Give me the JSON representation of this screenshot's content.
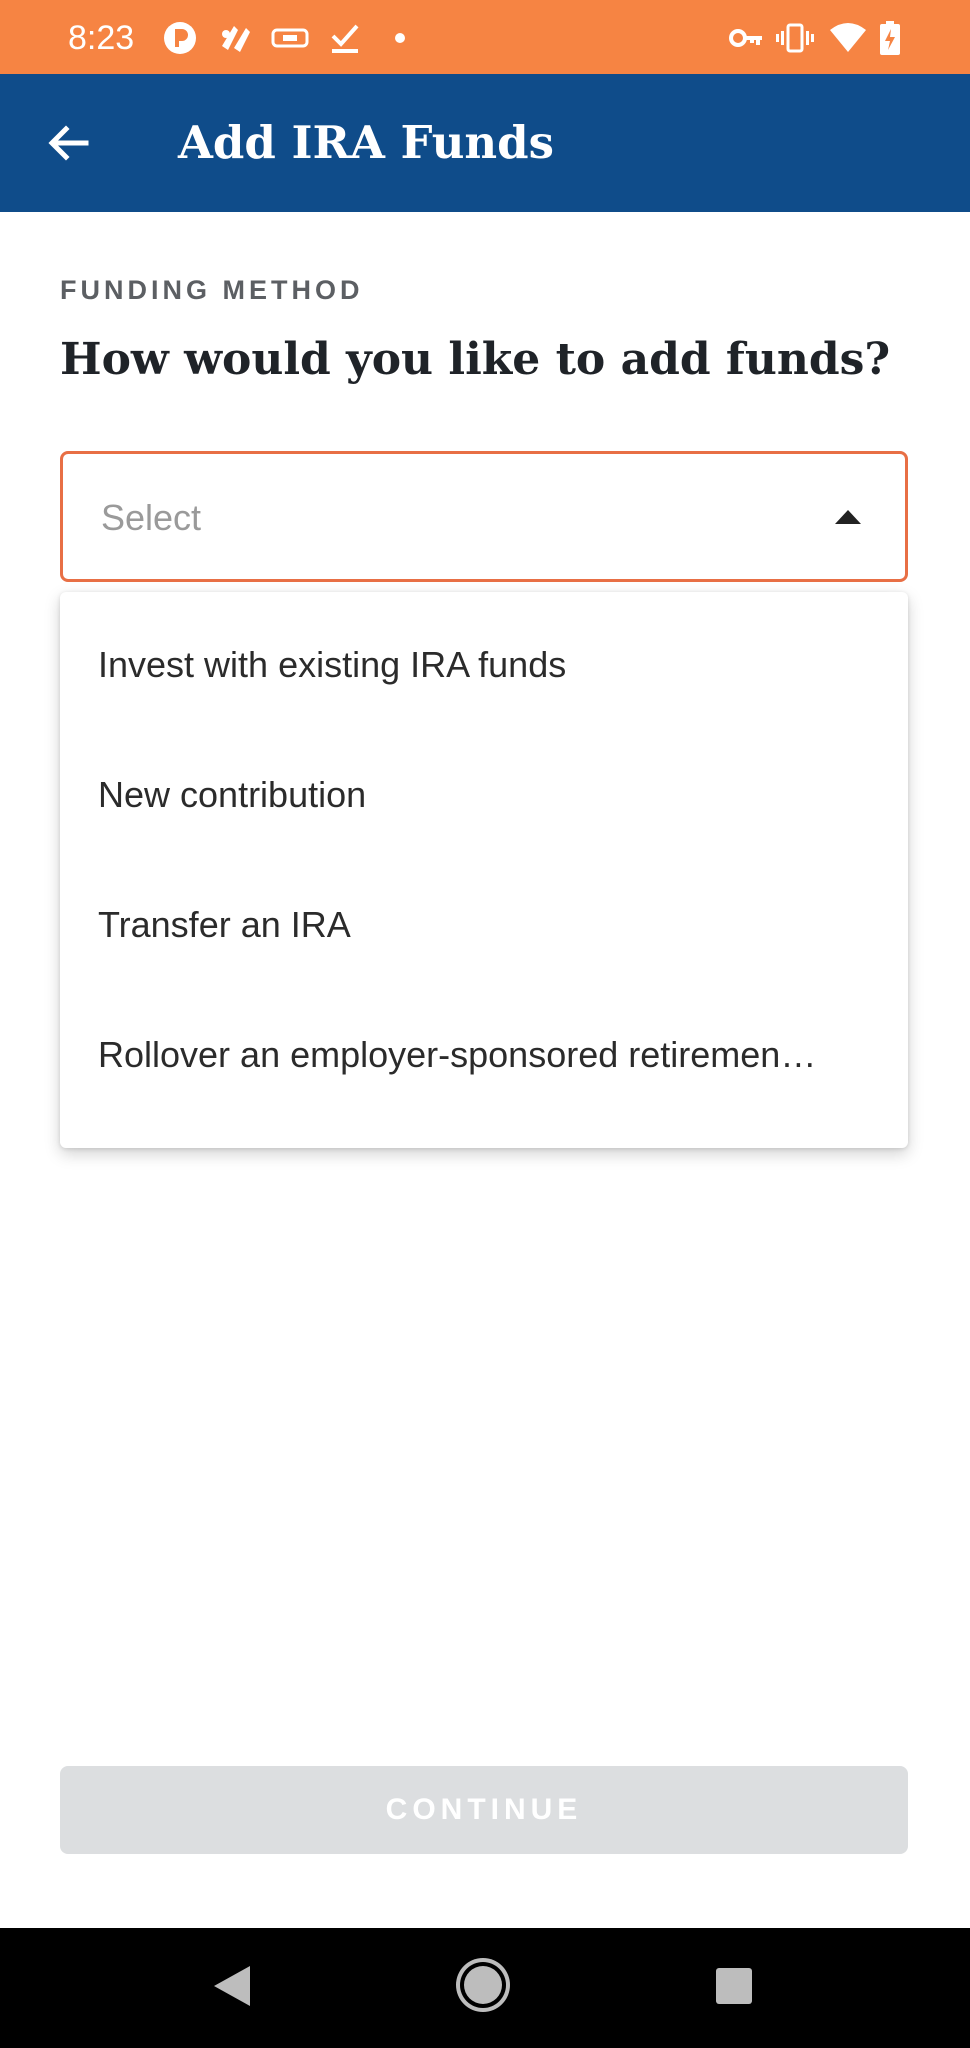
{
  "status_bar": {
    "time": "8:23",
    "left_icons": [
      "pocket-icon",
      "app-icon",
      "ticket-icon",
      "download-done-icon",
      "dot-icon"
    ],
    "right_icons": [
      "key-icon",
      "vibrate-icon",
      "wifi-icon",
      "battery-charging-icon"
    ],
    "background": "#f68443"
  },
  "app_bar": {
    "title": "Add IRA Funds",
    "back_icon": "arrow-left-icon",
    "background": "#0f4c8a"
  },
  "form": {
    "section_label": "FUNDING METHOD",
    "question": "How would you like to add funds?",
    "select": {
      "placeholder": "Select",
      "border_color": "#e86f45",
      "options": [
        {
          "label": "Invest with existing IRA funds"
        },
        {
          "label": "New contribution"
        },
        {
          "label": "Transfer an IRA"
        },
        {
          "label": "Rollover an employer-sponsored retiremen…"
        }
      ]
    },
    "continue_label": "CONTINUE"
  },
  "nav_bar": {
    "icons": [
      "nav-back-icon",
      "nav-home-icon",
      "nav-recents-icon"
    ]
  }
}
